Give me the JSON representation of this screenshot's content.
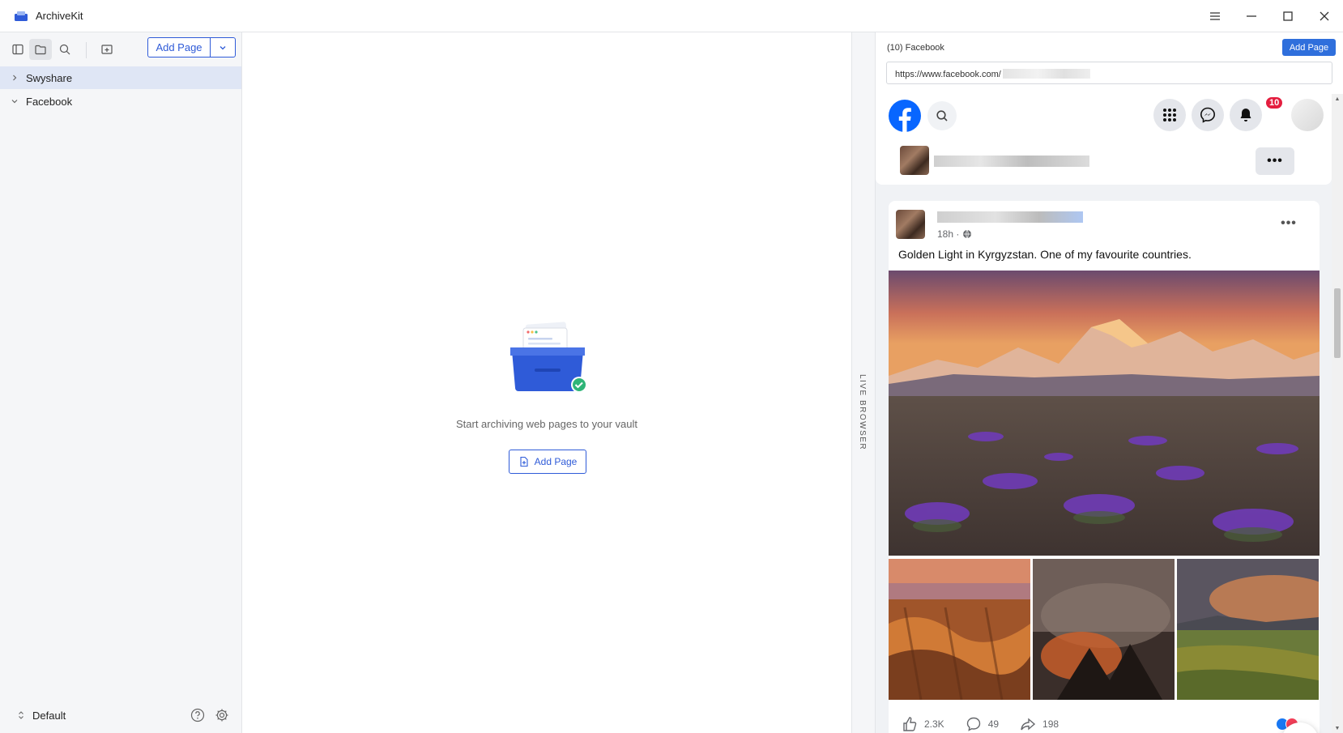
{
  "window": {
    "title": "ArchiveKit"
  },
  "toolbar": {
    "add_page_label": "Add Page"
  },
  "tree": {
    "items": [
      {
        "label": "Swyshare",
        "expanded": false,
        "selected": true
      },
      {
        "label": "Facebook",
        "expanded": true,
        "selected": false
      }
    ]
  },
  "sidebar_footer": {
    "vault_label": "Default"
  },
  "empty_state": {
    "message": "Start archiving web pages to your vault",
    "button_label": "Add Page"
  },
  "rail": {
    "label": "LIVE BROWSER"
  },
  "browser": {
    "tab_title": "(10) Facebook",
    "add_page_label": "Add Page",
    "url": "https://www.facebook.com/"
  },
  "facebook": {
    "notification_count": "10",
    "more_label": "•••",
    "post": {
      "time": "18h ·",
      "text": "Golden Light in Kyrgyzstan. One of my favourite countries.",
      "likes": "2.3K",
      "comments": "49",
      "shares": "198"
    }
  },
  "colors": {
    "accent": "#2f5bd8",
    "facebook_blue": "#0866ff",
    "badge_red": "#e41e3f",
    "sidebar_bg": "#f5f6f8",
    "selected_row": "#dfe6f5"
  },
  "icons": {
    "sidebar_toggle": "sidebar-toggle-icon",
    "folder": "folder-icon",
    "search": "search-icon",
    "new_folder": "folder-plus-icon",
    "help": "help-icon",
    "settings": "gear-icon",
    "menu": "hamburger-icon",
    "minimize": "minimize-icon",
    "maximize": "maximize-icon",
    "close": "close-icon"
  }
}
